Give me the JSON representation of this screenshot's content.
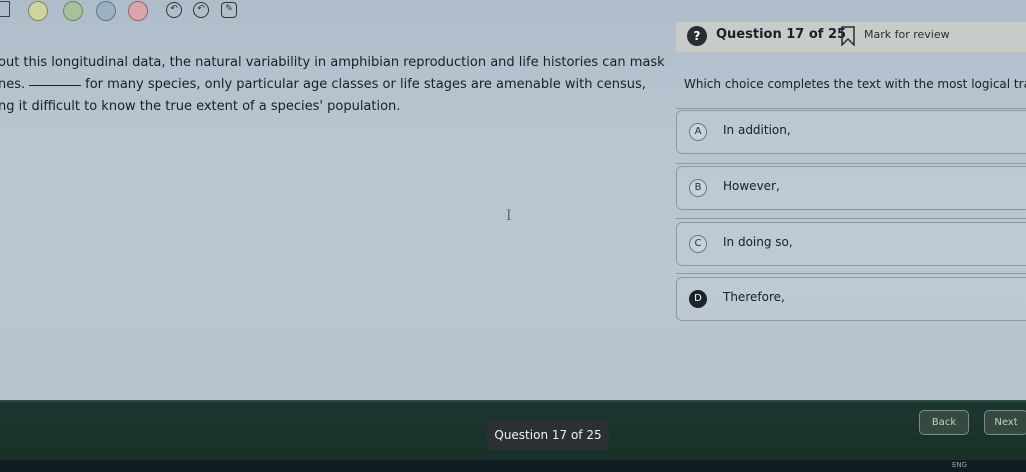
{
  "header": {
    "question_label": "Question 17 of 25",
    "mark_for_review": "Mark for review",
    "help_badge": "?"
  },
  "toolbar": {
    "icons": [
      "menu-icon",
      "circle-icon",
      "circle-icon",
      "circle-icon",
      "circle-icon",
      "undo-icon",
      "undo-icon",
      "highlight-icon"
    ],
    "undo_glyph": "↶",
    "highlight_glyph": "✎"
  },
  "passage": {
    "line1": "out this longitudinal data, the natural variability in amphibian reproduction and life histories can mask",
    "line2_before": "nes.",
    "line2_after": "for many species, only particular age classes or life stages are amenable with census,",
    "line3": "ng it difficult to know the true extent of a species' population."
  },
  "question": {
    "prompt": "Which choice completes the text with the most logical tra"
  },
  "choices": [
    {
      "letter": "A",
      "text": "In addition,"
    },
    {
      "letter": "B",
      "text": "However,"
    },
    {
      "letter": "C",
      "text": "In doing so,"
    },
    {
      "letter": "D",
      "text": "Therefore,"
    }
  ],
  "footer": {
    "pager": "Question 17 of 25",
    "back": "Back",
    "next": "Next"
  },
  "taskbar": {
    "language": "ENG"
  },
  "colors": {
    "background": "#b8c6d2",
    "bottom_bar": "#1d3630",
    "badge": "#2a2e33"
  }
}
